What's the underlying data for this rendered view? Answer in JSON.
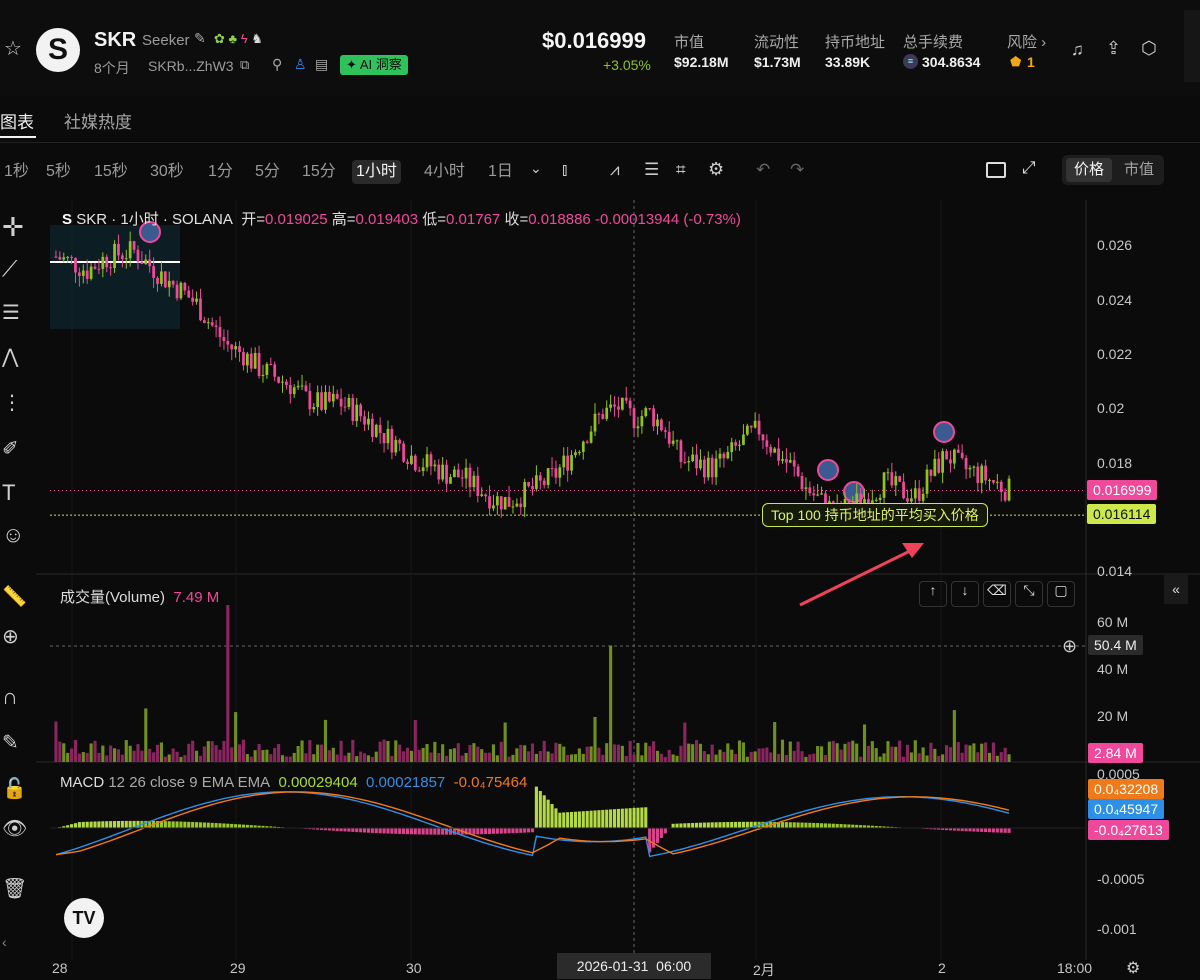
{
  "token": {
    "symbol": "SKR",
    "name": "Seeker",
    "age": "8个月",
    "address_short": "SKRb...ZhW3",
    "ai_badge": "AI 洞察",
    "price": "$0.016999",
    "change": "+3.05%"
  },
  "stats": [
    {
      "label": "市值",
      "value": "$92.18M"
    },
    {
      "label": "流动性",
      "value": "$1.73M"
    },
    {
      "label": "持币地址",
      "value": "33.89K"
    },
    {
      "label": "总手续费",
      "value": "304.8634"
    },
    {
      "label": "风险 ›",
      "value": "1"
    }
  ],
  "tabs": [
    "图表",
    "社媒热度"
  ],
  "timeframes": [
    "1秒",
    "5秒",
    "15秒",
    "30秒",
    "1分",
    "5分",
    "15分",
    "1小时",
    "4小时",
    "1日"
  ],
  "active_timeframe": "1小时",
  "price_mode": [
    "价格",
    "市值"
  ],
  "legend": {
    "title": "SKR · 1小时 · SOLANA",
    "open_label": "开=",
    "open": "0.019025",
    "high_label": "高=",
    "high": "0.019403",
    "low_label": "低=",
    "low": "0.01767",
    "close_label": "收=",
    "close": "0.018886",
    "change": "-0.00013944 (-0.73%)"
  },
  "price_axis": [
    "0.026",
    "0.024",
    "0.022",
    "0.02",
    "0.018",
    "0.014"
  ],
  "current_price_tag": "0.016999",
  "avg_buy_tag": "0.016114",
  "annotation": "Top 100 持币地址的平均买入价格",
  "volume": {
    "label": "成交量(Volume)",
    "value": "7.49 M",
    "axis": [
      "60 M",
      "40 M",
      "20 M"
    ],
    "crosshair_tag": "50.4 M",
    "current_tag": "2.84 M"
  },
  "macd": {
    "label": "MACD",
    "params": "12 26 close 9 EMA EMA",
    "v1": "0.00029404",
    "v2": "0.00021857",
    "v3": "-0.0₄75464",
    "axis": [
      "0.0005",
      "-0.0005",
      "-0.001"
    ],
    "tags": [
      "0.0₄32208",
      "0.0₄45947",
      "-0.0₄27613"
    ]
  },
  "time_axis": [
    "28",
    "29",
    "30",
    "2026-01-31  06:00",
    "2月",
    "2",
    "18:00"
  ],
  "colors": {
    "up": "#8fc41a",
    "down": "#f0499b",
    "macd_line": "#2e8fe6",
    "signal_line": "#f07a1a",
    "avg_line": "#cde84a"
  },
  "chart_data": {
    "type": "candlestick",
    "ylim": [
      0.014,
      0.026
    ],
    "ohlc_close_approx": [
      0.0254,
      0.0252,
      0.0249,
      0.0253,
      0.0255,
      0.0256,
      0.0251,
      0.0246,
      0.0242,
      0.0237,
      0.0229,
      0.0222,
      0.0219,
      0.0214,
      0.0211,
      0.0208,
      0.0203,
      0.0201,
      0.0202,
      0.0199,
      0.0195,
      0.019,
      0.0186,
      0.0181,
      0.0179,
      0.0176,
      0.0175,
      0.0171,
      0.0167,
      0.0166,
      0.0169,
      0.0172,
      0.0176,
      0.0183,
      0.0191,
      0.0198,
      0.02,
      0.0196,
      0.0198,
      0.0192,
      0.0181,
      0.018,
      0.0178,
      0.0182,
      0.0188,
      0.0192,
      0.0184,
      0.0179,
      0.0171,
      0.0166,
      0.0162,
      0.0165,
      0.0168,
      0.0173,
      0.017,
      0.0168,
      0.0176,
      0.0183,
      0.0178,
      0.0176,
      0.0173,
      0.017
    ]
  }
}
